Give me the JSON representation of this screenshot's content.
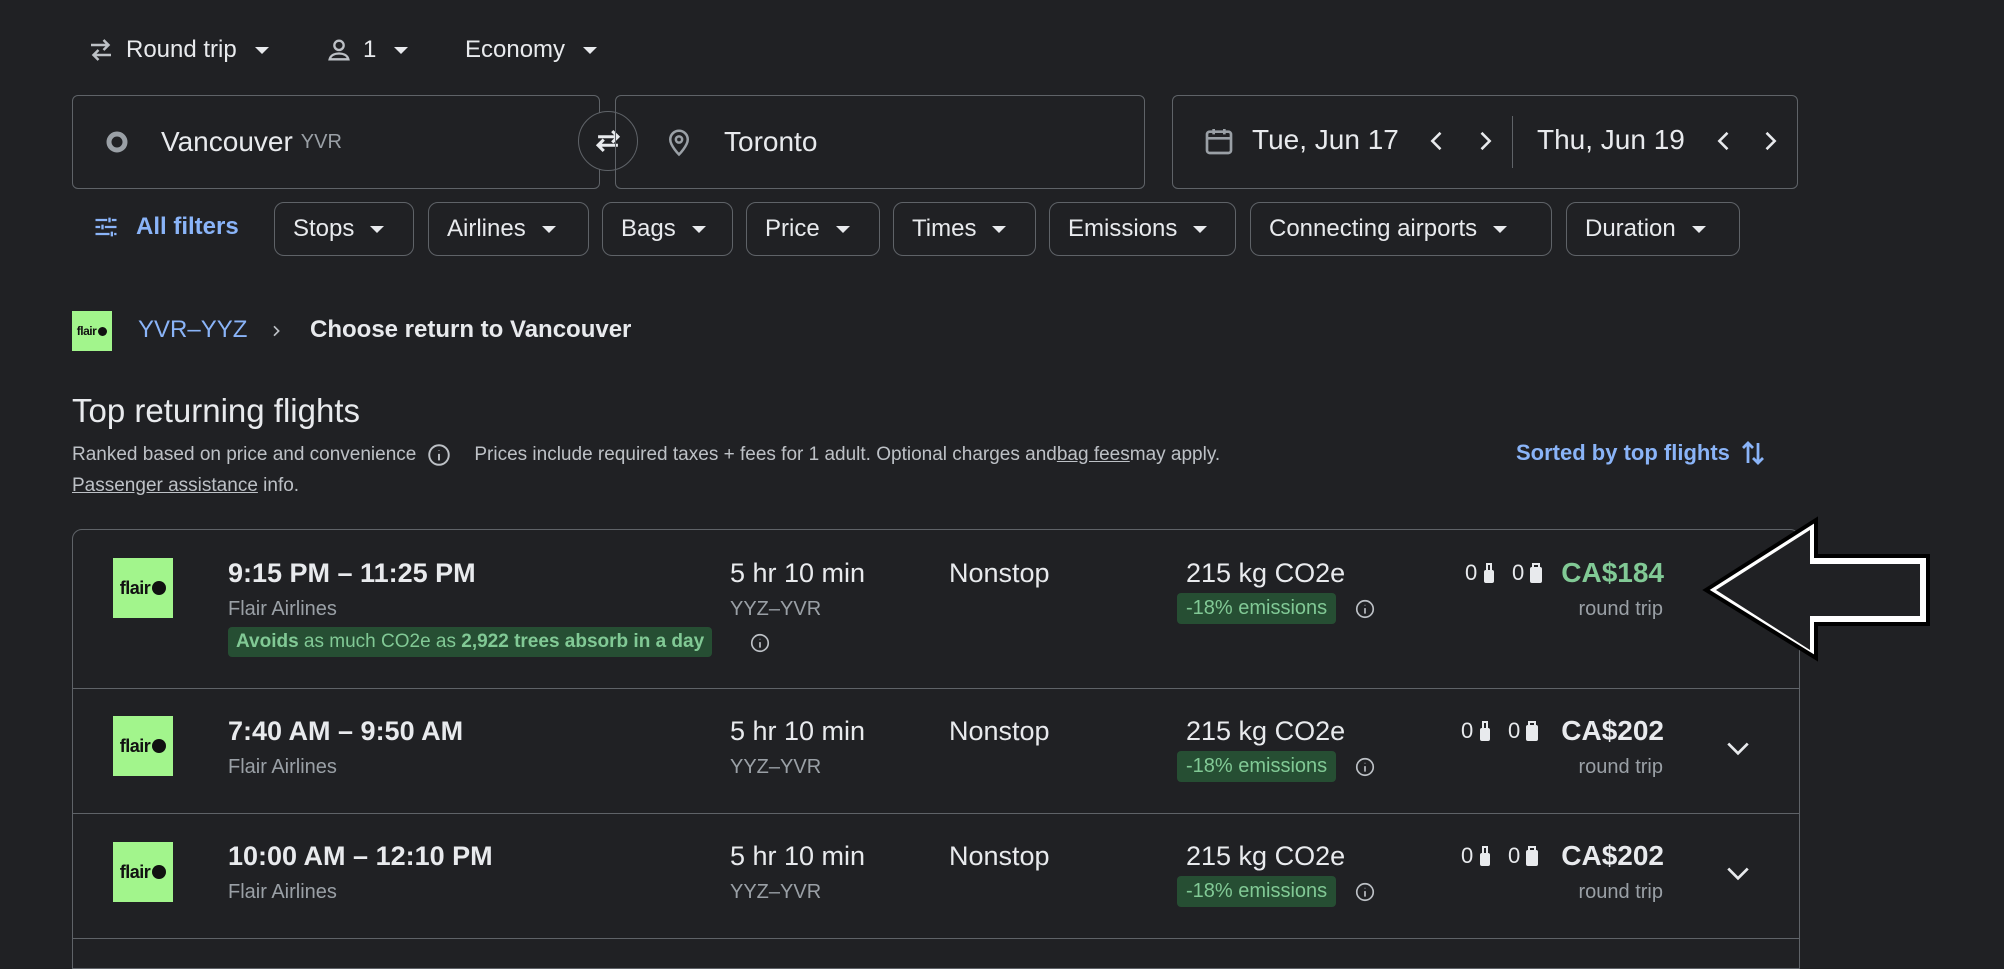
{
  "top": {
    "trip_type": "Round trip",
    "passengers": "1",
    "cabin": "Economy"
  },
  "search": {
    "origin": "Vancouver",
    "origin_code": "YVR",
    "destination": "Toronto",
    "depart_date": "Tue, Jun 17",
    "return_date": "Thu, Jun 19"
  },
  "filters": {
    "all_filters": "All filters",
    "chips": [
      "Stops",
      "Airlines",
      "Bags",
      "Price",
      "Times",
      "Emissions",
      "Connecting airports",
      "Duration"
    ]
  },
  "breadcrumb": {
    "route": "YVR–YYZ",
    "current": "Choose return to Vancouver",
    "logo_text": "flair"
  },
  "section": {
    "title": "Top returning flights",
    "ranked": "Ranked based on price and convenience",
    "prices_note_1": "Prices include required taxes + fees for 1 adult. Optional charges and ",
    "bag_fees": "bag fees",
    "prices_note_2": " may apply.",
    "passenger_assistance": "Passenger assistance",
    "info": " info.",
    "sorted": "Sorted by top flights"
  },
  "flights": [
    {
      "times": "9:15 PM – 11:25 PM",
      "airline": "Flair Airlines",
      "duration": "5 hr 10 min",
      "route": "YYZ–YVR",
      "stops": "Nonstop",
      "co2": "215 kg CO2e",
      "emissions": "-18% emissions",
      "carry_on": "0",
      "checked": "0",
      "price": "CA$184",
      "price_note": "round trip",
      "eco_avoids": "Avoids",
      "eco_mid": " as much CO2e as ",
      "eco_trees": "2,922 trees absorb in a day"
    },
    {
      "times": "7:40 AM – 9:50 AM",
      "airline": "Flair Airlines",
      "duration": "5 hr 10 min",
      "route": "YYZ–YVR",
      "stops": "Nonstop",
      "co2": "215 kg CO2e",
      "emissions": "-18% emissions",
      "carry_on": "0",
      "checked": "0",
      "price": "CA$202",
      "price_note": "round trip"
    },
    {
      "times": "10:00 AM – 12:10 PM",
      "airline": "Flair Airlines",
      "duration": "5 hr 10 min",
      "route": "YYZ–YVR",
      "stops": "Nonstop",
      "co2": "215 kg CO2e",
      "emissions": "-18% emissions",
      "carry_on": "0",
      "checked": "0",
      "price": "CA$202",
      "price_note": "round trip"
    }
  ],
  "colors": {
    "background": "#202124",
    "accent_blue": "#8ab4f8",
    "eco_green": "#81c995",
    "logo_green": "#a2f58c"
  }
}
